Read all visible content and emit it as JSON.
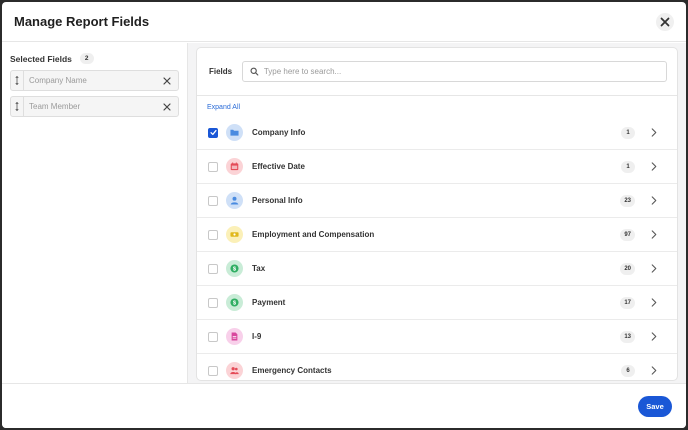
{
  "modal": {
    "title": "Manage Report Fields",
    "save_label": "Save"
  },
  "selected": {
    "title": "Selected Fields",
    "count": "2",
    "items": [
      {
        "label": "Company Name"
      },
      {
        "label": "Team Member"
      }
    ]
  },
  "fields": {
    "label": "Fields",
    "search_placeholder": "Type here to search...",
    "expand_all": "Expand All",
    "rows": [
      {
        "label": "Company Info",
        "count": "1",
        "checked": true,
        "icon": "folder-icon",
        "bg": "#cfe0f7",
        "fg": "#4a8be0"
      },
      {
        "label": "Effective Date",
        "count": "1",
        "checked": false,
        "icon": "calendar-icon",
        "bg": "#fbd3d6",
        "fg": "#e44b58"
      },
      {
        "label": "Personal Info",
        "count": "23",
        "checked": false,
        "icon": "person-icon",
        "bg": "#cfe0f7",
        "fg": "#4a8be0"
      },
      {
        "label": "Employment and Compensation",
        "count": "97",
        "checked": false,
        "icon": "money-card-icon",
        "bg": "#fbf0b8",
        "fg": "#e0b81a"
      },
      {
        "label": "Tax",
        "count": "20",
        "checked": false,
        "icon": "dollar-icon",
        "bg": "#c9ecd7",
        "fg": "#2fae62"
      },
      {
        "label": "Payment",
        "count": "17",
        "checked": false,
        "icon": "dollar-icon",
        "bg": "#c9ecd7",
        "fg": "#2fae62"
      },
      {
        "label": "I-9",
        "count": "13",
        "checked": false,
        "icon": "document-icon",
        "bg": "#f8d0ea",
        "fg": "#d9479e"
      },
      {
        "label": "Emergency Contacts",
        "count": "6",
        "checked": false,
        "icon": "people-icon",
        "bg": "#fbd3d6",
        "fg": "#e44b58"
      }
    ]
  }
}
